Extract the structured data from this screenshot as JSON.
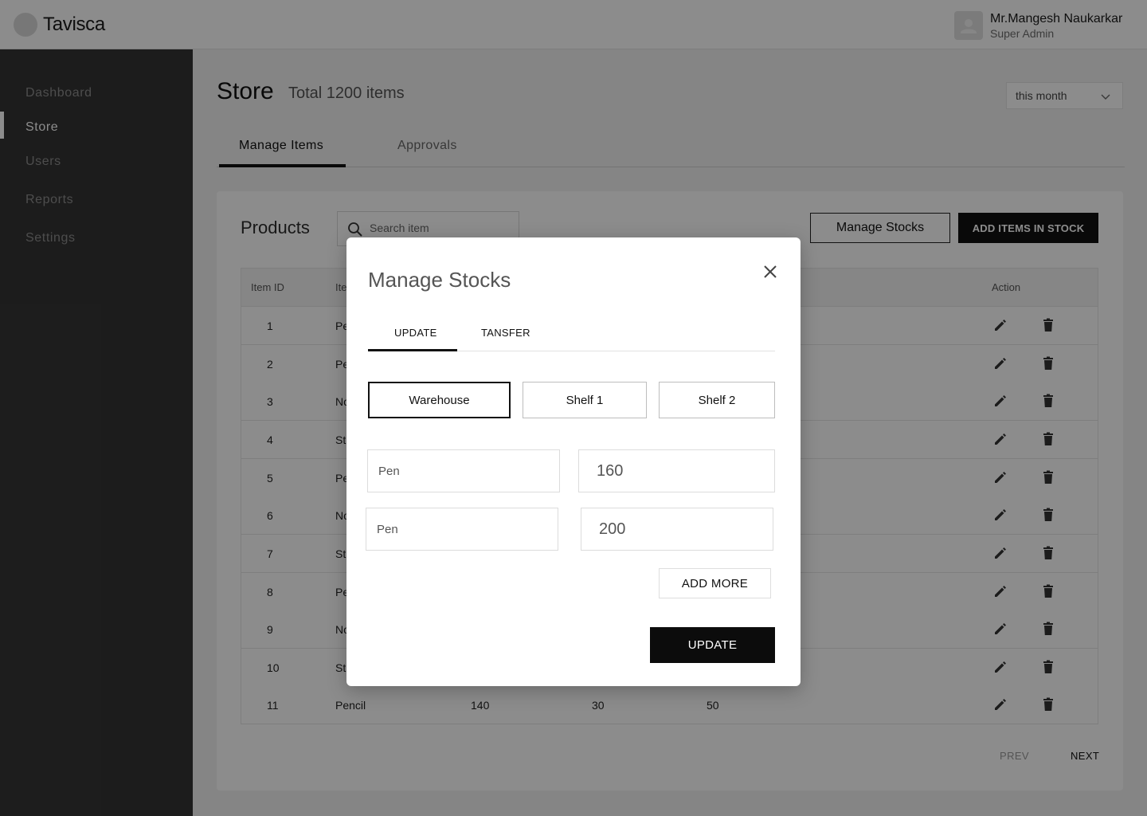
{
  "brand": "Tavisca",
  "user": {
    "name": "Mr.Mangesh Naukarkar",
    "role": "Super Admin"
  },
  "sidebar": {
    "items": [
      {
        "label": "Dashboard",
        "active": false
      },
      {
        "label": "Store",
        "active": true
      },
      {
        "label": "Users",
        "active": false
      },
      {
        "label": "Reports",
        "active": false
      },
      {
        "label": "Settings",
        "active": false
      }
    ]
  },
  "page": {
    "title": "Store",
    "subtitle": "Total 1200 items",
    "period": "this month"
  },
  "tabs": {
    "manage": "Manage Items",
    "approvals": "Approvals"
  },
  "products": {
    "title": "Products",
    "search_placeholder": "Search item",
    "manage_stocks_label": "Manage Stocks",
    "add_items_label": "ADD ITEMS IN STOCK"
  },
  "table": {
    "headers": {
      "id": "Item ID",
      "name": "Ite",
      "action": "Action"
    },
    "rows": [
      {
        "id": "1",
        "name": "Pe"
      },
      {
        "id": "2",
        "name": "Pe"
      },
      {
        "id": "3",
        "name": "No"
      },
      {
        "id": "4",
        "name": "St"
      },
      {
        "id": "5",
        "name": "Pe"
      },
      {
        "id": "6",
        "name": "No"
      },
      {
        "id": "7",
        "name": "St"
      },
      {
        "id": "8",
        "name": "Pe"
      },
      {
        "id": "9",
        "name": "No"
      },
      {
        "id": "10",
        "name": "St"
      },
      {
        "id": "11",
        "name": "Pencil",
        "a": "140",
        "b": "30",
        "c": "50"
      }
    ]
  },
  "pager": {
    "prev": "PREV",
    "next": "NEXT"
  },
  "modal": {
    "title": "Manage Stocks",
    "tabs": {
      "update": "UPDATE",
      "transfer": "TANSFER"
    },
    "locations": {
      "warehouse": "Warehouse",
      "shelf1": "Shelf 1",
      "shelf2": "Shelf 2"
    },
    "entries": [
      {
        "item": "Pen",
        "qty": "160"
      },
      {
        "item": "Pen",
        "qty": "200"
      }
    ],
    "add_more_label": "ADD MORE",
    "update_label": "UPDATE"
  },
  "colors": {
    "accent": "#111111",
    "sidebar": "#343434",
    "overlay": "rgba(0,0,0,0.45)"
  }
}
